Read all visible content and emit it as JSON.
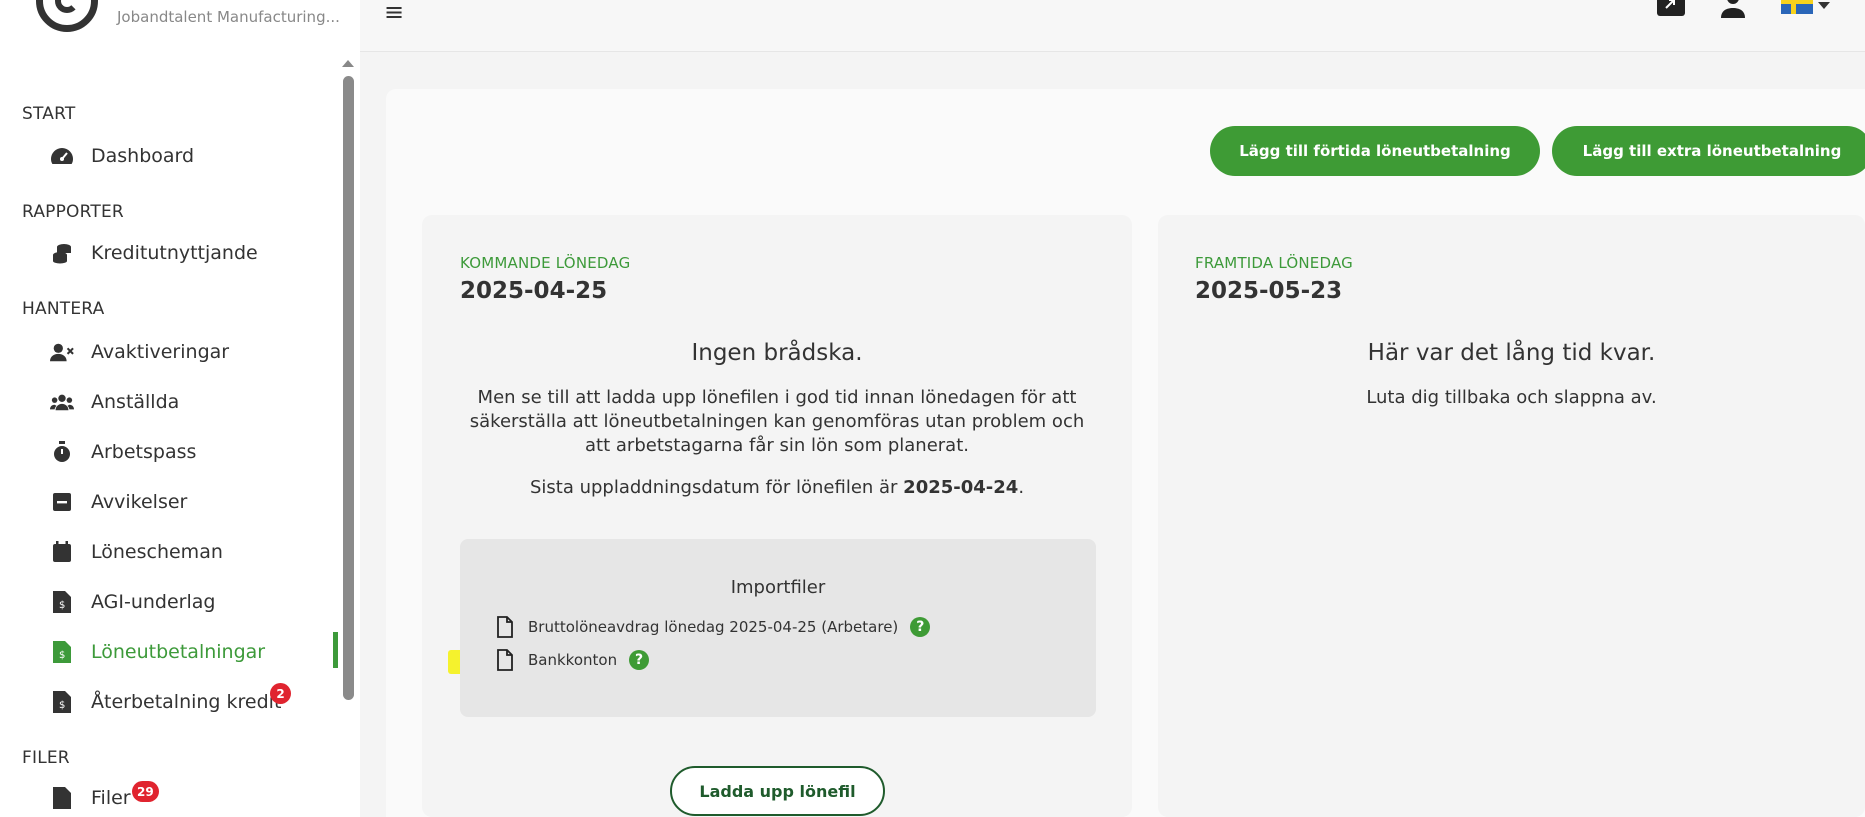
{
  "sidebar": {
    "company": "Jobandtalent Manufacturing...",
    "sections": [
      {
        "title": "START"
      },
      {
        "title": "RAPPORTER"
      },
      {
        "title": "HANTERA"
      },
      {
        "title": "FILER"
      }
    ],
    "items": [
      {
        "label": "Dashboard",
        "icon": "gauge-icon"
      },
      {
        "label": "Kreditutnyttjande",
        "icon": "coins-icon"
      },
      {
        "label": "Avaktiveringar",
        "icon": "user-x-icon"
      },
      {
        "label": "Anställda",
        "icon": "users-icon"
      },
      {
        "label": "Arbetspass",
        "icon": "stopwatch-icon"
      },
      {
        "label": "Avvikelser",
        "icon": "minus-square-icon"
      },
      {
        "label": "Lönescheman",
        "icon": "calendar-icon"
      },
      {
        "label": "AGI-underlag",
        "icon": "invoice-icon"
      },
      {
        "label": "Löneutbetalningar",
        "icon": "invoice-icon",
        "active": true
      },
      {
        "label": "Återbetalning kredit",
        "icon": "invoice-icon",
        "badge": "2"
      },
      {
        "label": "Filer",
        "icon": "file-icon",
        "badge": "29"
      }
    ]
  },
  "topbar": {
    "menu_icon": "hamburger-icon",
    "language": "Svenska"
  },
  "actions": {
    "add_early": "Lägg till förtida löneutbetalning",
    "add_extra": "Lägg till extra löneutbetalning"
  },
  "upcoming": {
    "label": "KOMMANDE LÖNEDAG",
    "date": "2025-04-25",
    "heading": "Ingen brådska.",
    "text": "Men se till att ladda upp lönefilen i god tid innan lönedagen för att säkerställa att löneutbetalningen kan genomföras utan problem och att arbetstagarna får sin lön som planerat.",
    "deadline_prefix": "Sista uppladdningsdatum för lönefilen är ",
    "deadline_date": "2025-04-24",
    "deadline_suffix": ".",
    "import_title": "Importfiler",
    "files": [
      {
        "name": "Bruttolöneavdrag lönedag 2025-04-25 (Arbetare)"
      },
      {
        "name": "Bankkonton"
      }
    ],
    "upload_button": "Ladda upp lönefil"
  },
  "future": {
    "label": "FRAMTIDA LÖNEDAG",
    "date": "2025-05-23",
    "heading": "Här var det lång tid kvar.",
    "text": "Luta dig tillbaka och slappna av."
  },
  "colors": {
    "accent": "#3e9b35",
    "badge": "#e0242f",
    "highlight": "#f5f22d"
  }
}
